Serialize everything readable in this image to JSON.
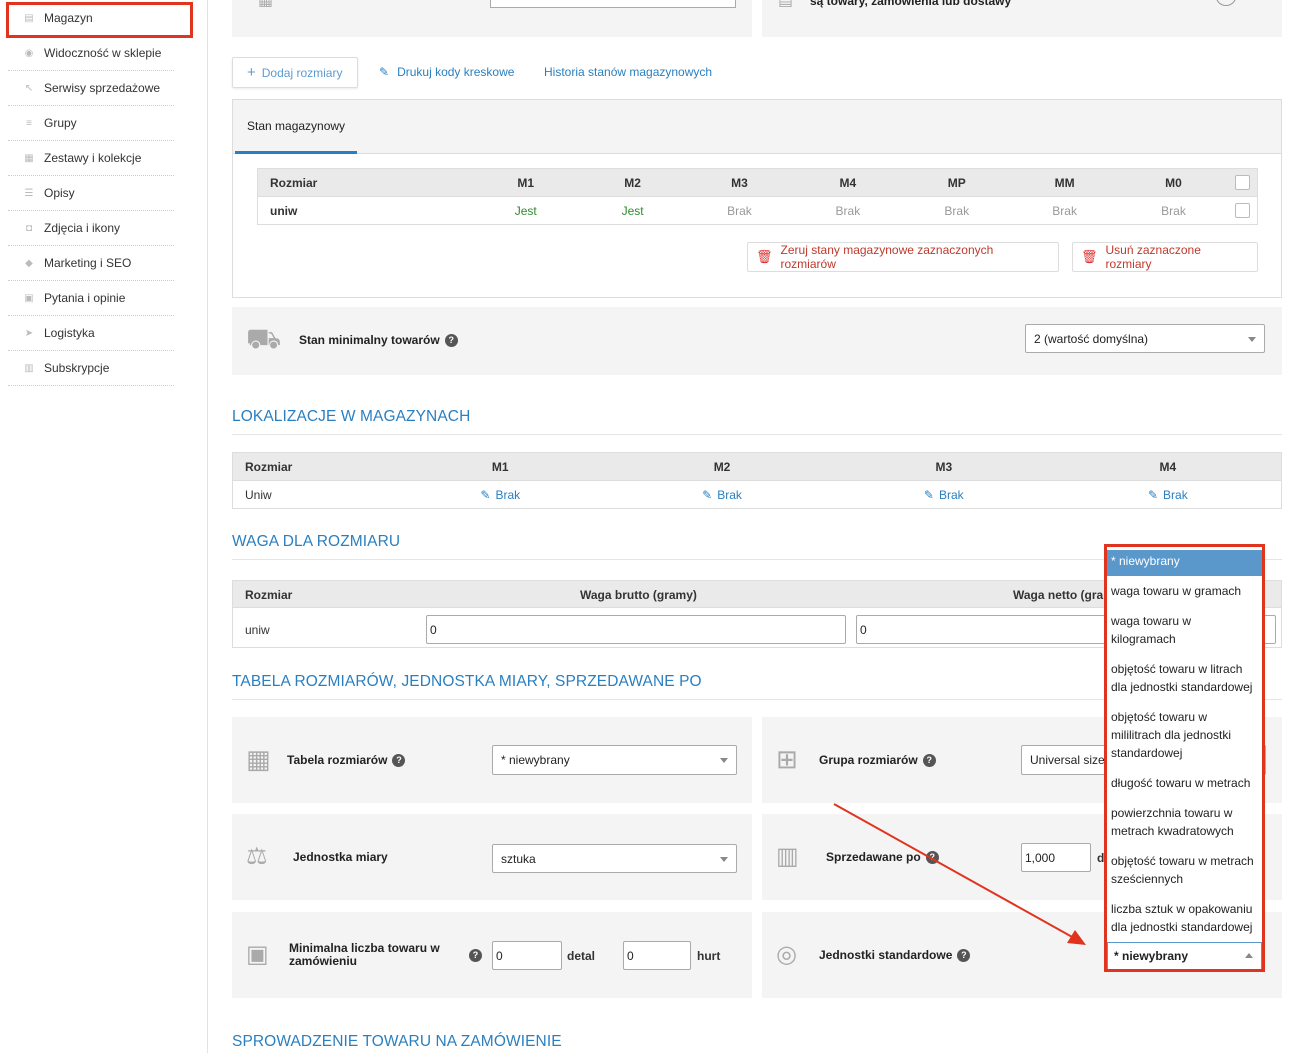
{
  "sidebar": {
    "items": [
      {
        "label": "Magazyn",
        "icon": "warehouse-icon"
      },
      {
        "label": "Widoczność w sklepie",
        "icon": "eye-icon"
      },
      {
        "label": "Serwisy sprzedażowe",
        "icon": "marketplace-icon"
      },
      {
        "label": "Grupy",
        "icon": "layers-icon"
      },
      {
        "label": "Zestawy i kolekcje",
        "icon": "sets-icon"
      },
      {
        "label": "Opisy",
        "icon": "text-icon"
      },
      {
        "label": "Zdjęcia i ikony",
        "icon": "camera-icon"
      },
      {
        "label": "Marketing i SEO",
        "icon": "tag-icon"
      },
      {
        "label": "Pytania i opinie",
        "icon": "comment-icon"
      },
      {
        "label": "Logistyka",
        "icon": "send-icon"
      },
      {
        "label": "Subskrypcje",
        "icon": "calendar-icon"
      }
    ]
  },
  "top": {
    "partial_text": "są towary, zamówienia lub dostawy"
  },
  "actions": {
    "add_sizes": "Dodaj rozmiary",
    "print_barcodes": "Drukuj kody kreskowe",
    "stock_history": "Historia stanów magazynowych"
  },
  "stock": {
    "tab": "Stan magazynowy",
    "headers": [
      "Rozmiar",
      "M1",
      "M2",
      "M3",
      "M4",
      "MP",
      "MM",
      "M0"
    ],
    "row": [
      "uniw",
      "Jest",
      "Jest",
      "Brak",
      "Brak",
      "Brak",
      "Brak",
      "Brak"
    ],
    "reset_button": "Zeruj stany magazynowe zaznaczonych rozmiarów",
    "delete_button": "Usuń zaznaczone rozmiary"
  },
  "min_stock": {
    "label": "Stan minimalny towarów",
    "value": "2 (wartość domyślna)"
  },
  "locations": {
    "title": "LOKALIZACJE W MAGAZYNACH",
    "headers": [
      "Rozmiar",
      "M1",
      "M2",
      "M3",
      "M4"
    ],
    "row": [
      "Uniw",
      "Brak",
      "Brak",
      "Brak",
      "Brak"
    ]
  },
  "weight": {
    "title": "WAGA DLA ROZMIARU",
    "headers": [
      "Rozmiar",
      "Waga brutto (gramy)",
      "Waga netto (gramy)"
    ],
    "row_label": "uniw",
    "brutto": "0",
    "netto": "0"
  },
  "sizes_table": {
    "title": "TABELA ROZMIARÓW, JEDNOSTKA MIARY, SPRZEDAWANE PO",
    "size_table_label": "Tabela rozmiarów",
    "size_table_value": "* niewybrany",
    "size_group_label": "Grupa rozmiarów",
    "size_group_value": "Universal size",
    "unit_label": "Jednostka miary",
    "unit_value": "sztuka",
    "sold_by_label": "Sprzedawane po",
    "sold_by_value": "1,000",
    "sold_by_suffix": "d",
    "min_order_label": "Minimalna liczba towaru w zamówieniu",
    "min_retail": "0",
    "retail_label": "detal",
    "min_wholesale": "0",
    "wholesale_label": "hurt",
    "std_units_label": "Jednostki standardowe",
    "std_units_value": "* niewybrany"
  },
  "dropdown": {
    "options": [
      "* niewybrany",
      "waga towaru w gramach",
      "waga towaru w kilogramach",
      "objętość towaru w litrach dla jednostki standardowej",
      "objętość towaru w mililitrach dla jednostki standardowej",
      "długość towaru w metrach",
      "powierzchnia towaru w metrach kwadratowych",
      "objętość towaru w metrach sześciennych",
      "liczba sztuk w opakowaniu dla jednostki standardowej"
    ]
  },
  "check": {
    "title": "SPROWADZENIE TOWARU NA ZAMÓWIENIE"
  },
  "colors": {
    "accent": "#2a7fc0",
    "highlight": "#e0341e",
    "in_stock": "#2e8b2e",
    "selected_option": "#5a98cc"
  }
}
